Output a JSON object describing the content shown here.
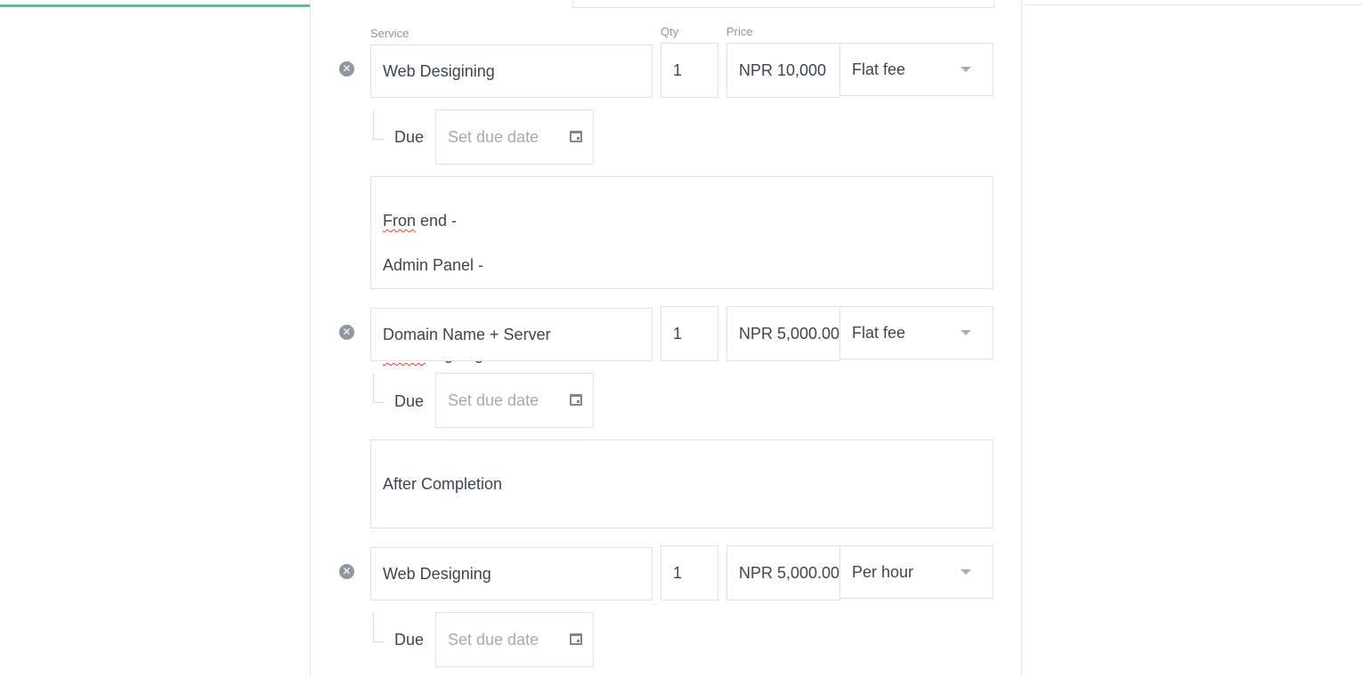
{
  "progress": {
    "fraction": 0.293,
    "color": "#35c9b6"
  },
  "columns": {
    "service": "Service",
    "qty": "Qty",
    "price": "Price"
  },
  "items": [
    {
      "service": "Web Desigining",
      "qty": "1",
      "price": "NPR 10,000",
      "rate": "Flat fee",
      "due_label": "Due",
      "due_placeholder": "Set due date",
      "description": [
        "Fron end -",
        "Admin Panel -",
        "",
        "Proior Signing"
      ]
    },
    {
      "service": "Domain Name + Server",
      "qty": "1",
      "price": "NPR 5,000.00",
      "rate": "Flat fee",
      "due_label": "Due",
      "due_placeholder": "Set due date",
      "description": [
        "After Completion"
      ]
    },
    {
      "service": "Web Designing",
      "qty": "1",
      "price": "NPR 5,000.00",
      "rate": "Per hour",
      "due_label": "Due",
      "due_placeholder": "Set due date"
    }
  ],
  "icons": {
    "remove": "remove-circle-icon",
    "calendar": "calendar-icon",
    "dropdown": "chevron-down-icon"
  }
}
